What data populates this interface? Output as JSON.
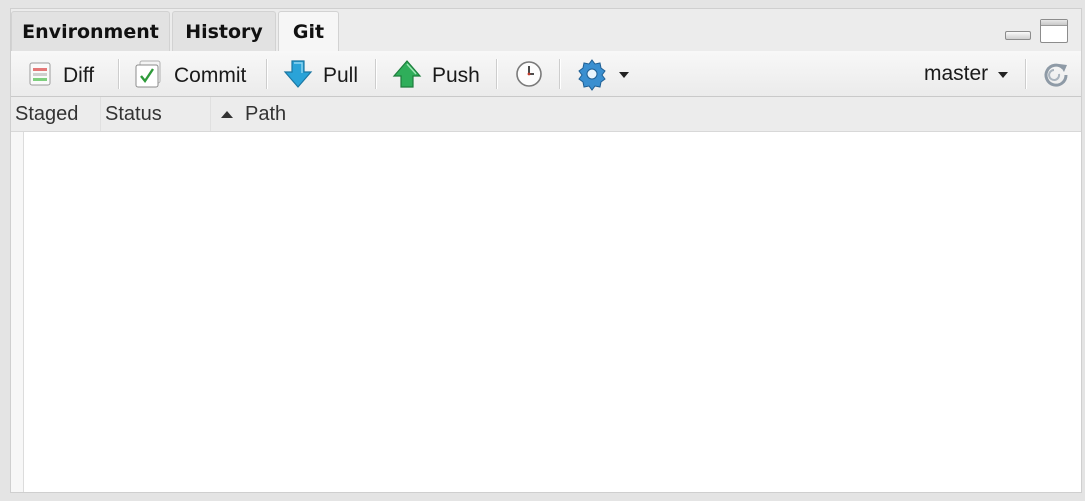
{
  "tabs": [
    {
      "label": "Environment",
      "active": false
    },
    {
      "label": "History",
      "active": false
    },
    {
      "label": "Git",
      "active": true
    }
  ],
  "toolbar": {
    "diff_label": "Diff",
    "commit_label": "Commit",
    "pull_label": "Pull",
    "push_label": "Push",
    "branch": "master",
    "icons": {
      "diff": "diff-icon",
      "commit": "commit-checkbox-icon",
      "pull": "pull-arrow-down-icon",
      "push": "push-arrow-up-icon",
      "history": "clock-icon",
      "more": "gear-icon",
      "refresh": "refresh-icon"
    },
    "colors": {
      "pull": "#2aa3d8",
      "push": "#2fae5a",
      "gear": "#3a8fd0"
    }
  },
  "table": {
    "columns": [
      {
        "label": "Staged"
      },
      {
        "label": "Status"
      },
      {
        "label": "Path",
        "sorted": "ascending"
      }
    ],
    "rows": []
  }
}
